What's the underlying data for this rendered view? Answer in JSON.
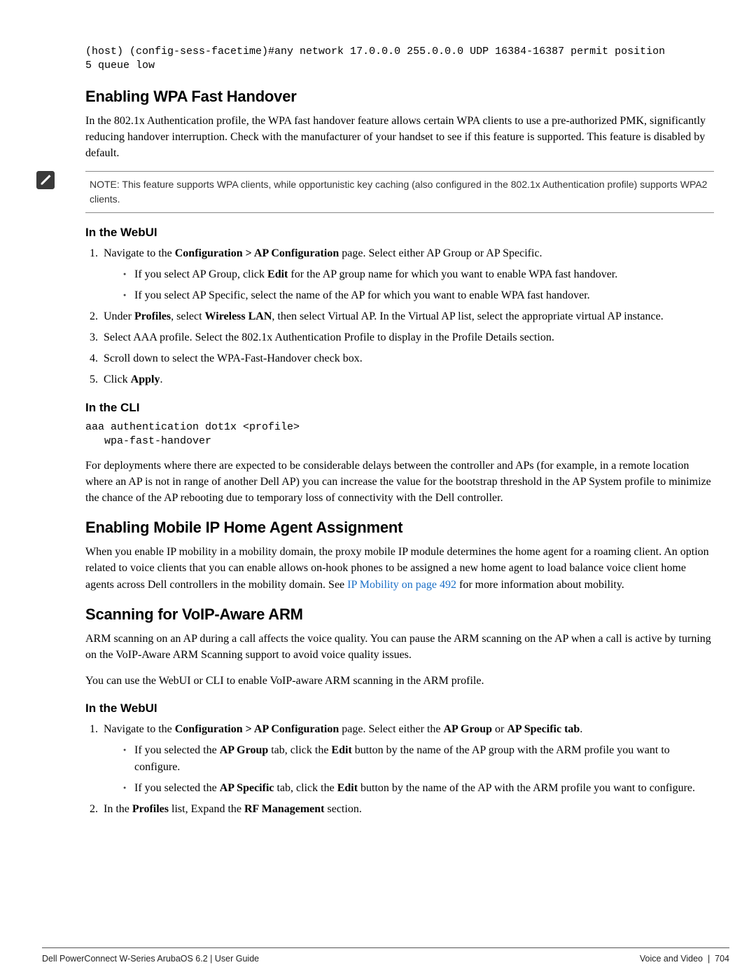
{
  "code_top": "(host) (config-sess-facetime)#any network 17.0.0.0 255.0.0.0 UDP 16384-16387 permit position\n5 queue low",
  "s1": {
    "title": "Enabling WPA Fast Handover",
    "intro": "In the 802.1x Authentication profile, the WPA fast handover feature allows certain WPA clients to use a pre-authorized PMK, significantly reducing handover interruption. Check with the manufacturer of your handset to see if this feature is supported. This feature is disabled by default.",
    "note": "NOTE: This feature supports WPA clients, while opportunistic key caching (also configured in the 802.1x Authentication profile) supports WPA2 clients.",
    "webui_heading": "In the WebUI",
    "step1_pre": "Navigate to the ",
    "step1_b": "Configuration > AP Configuration",
    "step1_post": " page. Select either AP Group or AP Specific.",
    "step1_a_pre": "If you select AP Group, click ",
    "step1_a_b": "Edit",
    "step1_a_post": " for the AP group name for which you want to enable WPA fast handover.",
    "step1_b2": "If you select AP Specific, select the name of the AP for which you want to enable WPA fast handover.",
    "step2_pre": "Under ",
    "step2_b1": "Profiles",
    "step2_mid": ", select ",
    "step2_b2": "Wireless LAN",
    "step2_post": ", then select Virtual AP. In the Virtual AP list, select the appropriate virtual AP instance.",
    "step3": "Select AAA profile. Select the 802.1x Authentication Profile to display in the Profile Details section.",
    "step4": "Scroll down to select the WPA-Fast-Handover check box.",
    "step5_pre": "Click ",
    "step5_b": "Apply",
    "step5_post": ".",
    "cli_heading": "In the CLI",
    "cli_code": "aaa authentication dot1x <profile>\n   wpa-fast-handover",
    "cli_body": "For deployments where there are expected to be considerable delays between the controller and APs (for example, in a remote location where an AP is not in range of another Dell AP) you can increase the value for the bootstrap threshold in the AP System profile to minimize the chance of the AP rebooting due to temporary loss of connectivity with the Dell  controller."
  },
  "s2": {
    "title": "Enabling Mobile IP Home Agent Assignment",
    "body_pre": "When you enable IP mobility in a mobility domain, the proxy mobile IP module determines the home agent for a roaming client. An option related to voice clients that you can enable allows on-hook phones to be assigned a new home agent to load balance voice client home agents across Dell controllers in the mobility domain. See ",
    "link": "IP Mobility on page 492",
    "body_post": " for more information about mobility."
  },
  "s3": {
    "title": "Scanning for VoIP-Aware ARM",
    "p1": "ARM scanning on an AP during a call affects the voice quality. You can pause the ARM scanning on the AP when a call is active by turning on the VoIP-Aware ARM Scanning support to avoid voice quality issues.",
    "p2": "You can use the WebUI or CLI to enable VoIP-aware ARM scanning in the ARM profile.",
    "webui_heading": "In the WebUI",
    "step1_pre": "Navigate to the ",
    "step1_b1": "Configuration > AP Configuration",
    "step1_mid": " page. Select either the ",
    "step1_b2": "AP Group",
    "step1_or": " or ",
    "step1_b3": "AP Specific tab",
    "step1_post": ".",
    "b1_pre": "If you selected the ",
    "b1_b1": "AP Group",
    "b1_mid": " tab, click the ",
    "b1_b2": "Edit",
    "b1_post": " button by the name of the AP group with the ARM profile you want to configure.",
    "b2_pre": "If you selected the ",
    "b2_b1": "AP Specific",
    "b2_mid": " tab, click the ",
    "b2_b2": "Edit",
    "b2_post": " button by the name of the AP with the ARM profile you want to configure.",
    "step2_pre": "In the ",
    "step2_b1": "Profiles",
    "step2_mid": " list, Expand the ",
    "step2_b2": "RF Management",
    "step2_post": " section."
  },
  "footer": {
    "left": "Dell PowerConnect W-Series ArubaOS 6.2 | User Guide",
    "right": "Voice and Video  |  704"
  }
}
